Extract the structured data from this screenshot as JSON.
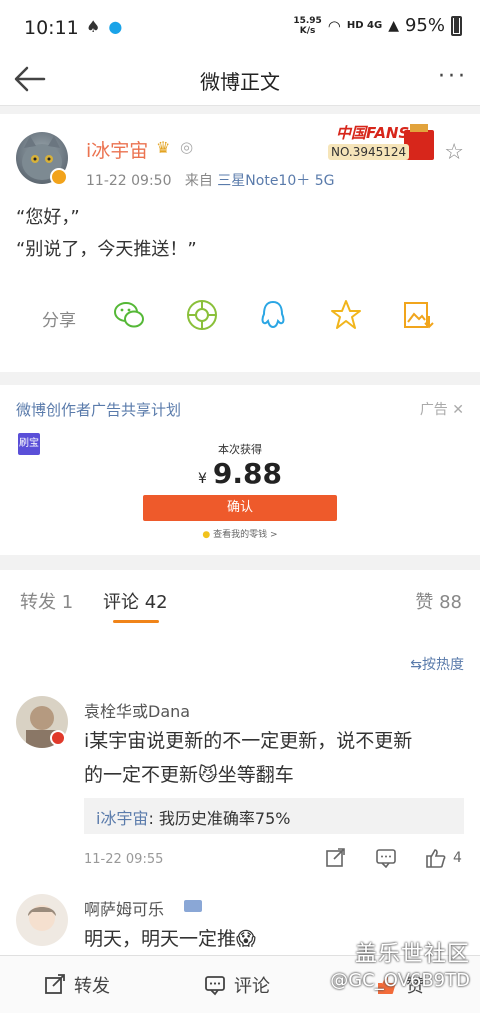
{
  "status_bar": {
    "time": "10:11",
    "speed_top": "15.95",
    "speed_unit": "K/s",
    "network": "HD 4G",
    "battery": "95%"
  },
  "navbar": {
    "title": "微博正文",
    "more": "···"
  },
  "post": {
    "username": "i冰宇宙",
    "fans_badge_title": "中国FANS",
    "fans_badge_no": "NO.3945124",
    "time": "11-22 09:50",
    "source_prefix": "来自",
    "source": "三星Note10＋ 5G",
    "line1": "“您好，”",
    "line2": "“别说了，今天推送！”",
    "share_label": "分享"
  },
  "ad": {
    "title": "微博创作者广告共享计划",
    "tag": "广告",
    "logo": "刷宝",
    "sub": "本次获得",
    "currency": "¥",
    "amount": "9.88",
    "button": "确认",
    "link": "查看我的零钱 >"
  },
  "tabs": {
    "repost": "转发 1",
    "comment": "评论 42",
    "like": "赞 88"
  },
  "sort": "按热度",
  "comments": [
    {
      "name": "袁栓华或Dana",
      "text1": "i某宇宙说更新的不一定更新，说不更新",
      "text2": "的一定不更新😼坐等翻车",
      "reply_name": "i冰宇宙",
      "reply_text": ": 我历史准确率75%",
      "time": "11-22 09:55",
      "likes": "4"
    },
    {
      "name": "啊萨姆可乐",
      "text1": "明天，明天一定推😱"
    }
  ],
  "bottom": {
    "repost": "转发",
    "comment": "评论",
    "like": "赞"
  },
  "watermark": {
    "line1": "盖乐世社区",
    "line2": "@GC_OV6B9TD"
  }
}
